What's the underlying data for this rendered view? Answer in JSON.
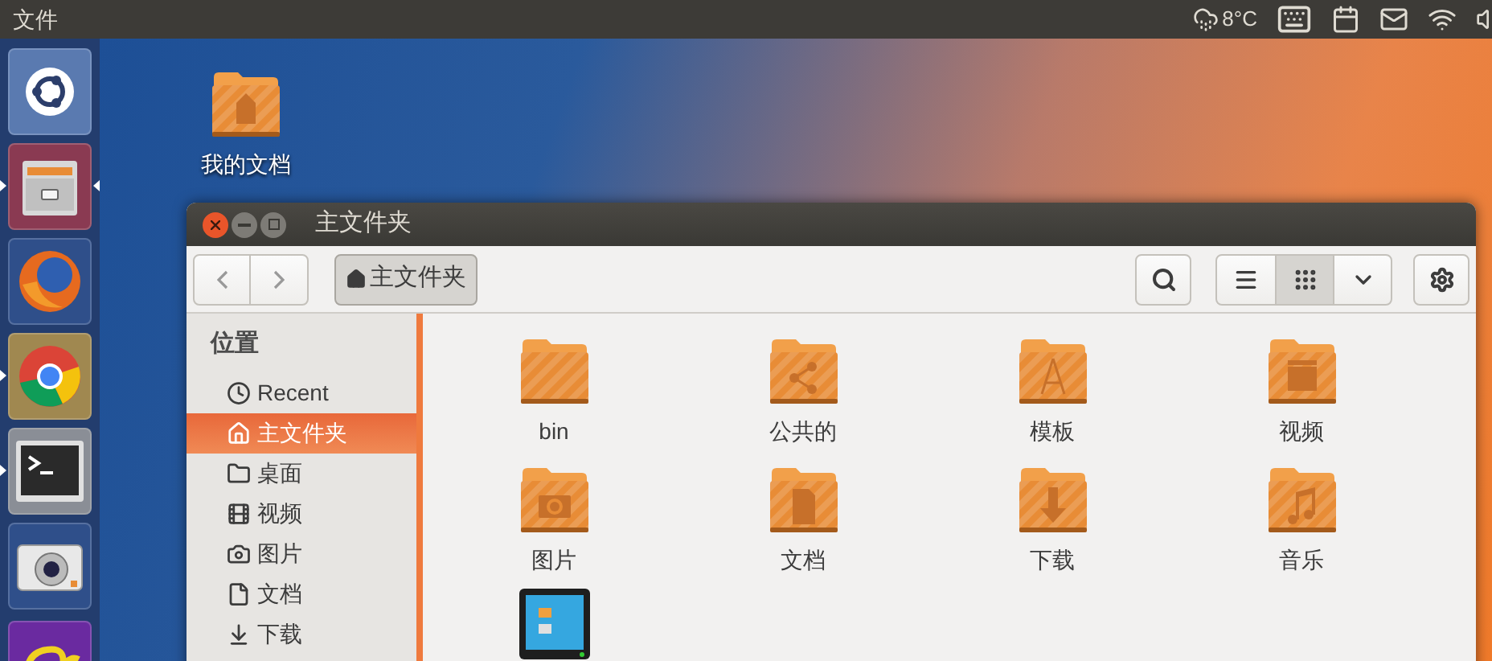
{
  "top_bar": {
    "app_menu": "文件",
    "temperature": "8°C"
  },
  "launcher": [
    {
      "running": false,
      "focused": false
    },
    {
      "running": true,
      "focused": true
    },
    {
      "running": false,
      "focused": false
    },
    {
      "running": true,
      "focused": false
    },
    {
      "running": true,
      "focused": false
    },
    {
      "running": false,
      "focused": false
    },
    {
      "running": false,
      "focused": false
    }
  ],
  "desktop_icons": [
    {
      "label": "我的文档"
    }
  ],
  "window": {
    "title": "主文件夹",
    "path": "主文件夹",
    "view_buttons": [
      {
        "selected": false
      },
      {
        "selected": true
      },
      {
        "selected": false
      }
    ],
    "sidebar": {
      "heading": "位置",
      "items": [
        {
          "label": "Recent",
          "selected": false
        },
        {
          "label": "主文件夹",
          "selected": true
        },
        {
          "label": "桌面",
          "selected": false
        },
        {
          "label": "视频",
          "selected": false
        },
        {
          "label": "图片",
          "selected": false
        },
        {
          "label": "文档",
          "selected": false
        },
        {
          "label": "下载",
          "selected": false
        }
      ]
    },
    "files": [
      {
        "kind": "folder",
        "label": "bin"
      },
      {
        "kind": "folder",
        "label": "公共的"
      },
      {
        "kind": "folder",
        "label": "模板"
      },
      {
        "kind": "folder",
        "label": "视频"
      },
      {
        "kind": "folder",
        "label": "图片"
      },
      {
        "kind": "folder",
        "label": "文档"
      },
      {
        "kind": "folder",
        "label": "下载"
      },
      {
        "kind": "folder",
        "label": "音乐"
      },
      {
        "kind": "app"
      }
    ]
  }
}
